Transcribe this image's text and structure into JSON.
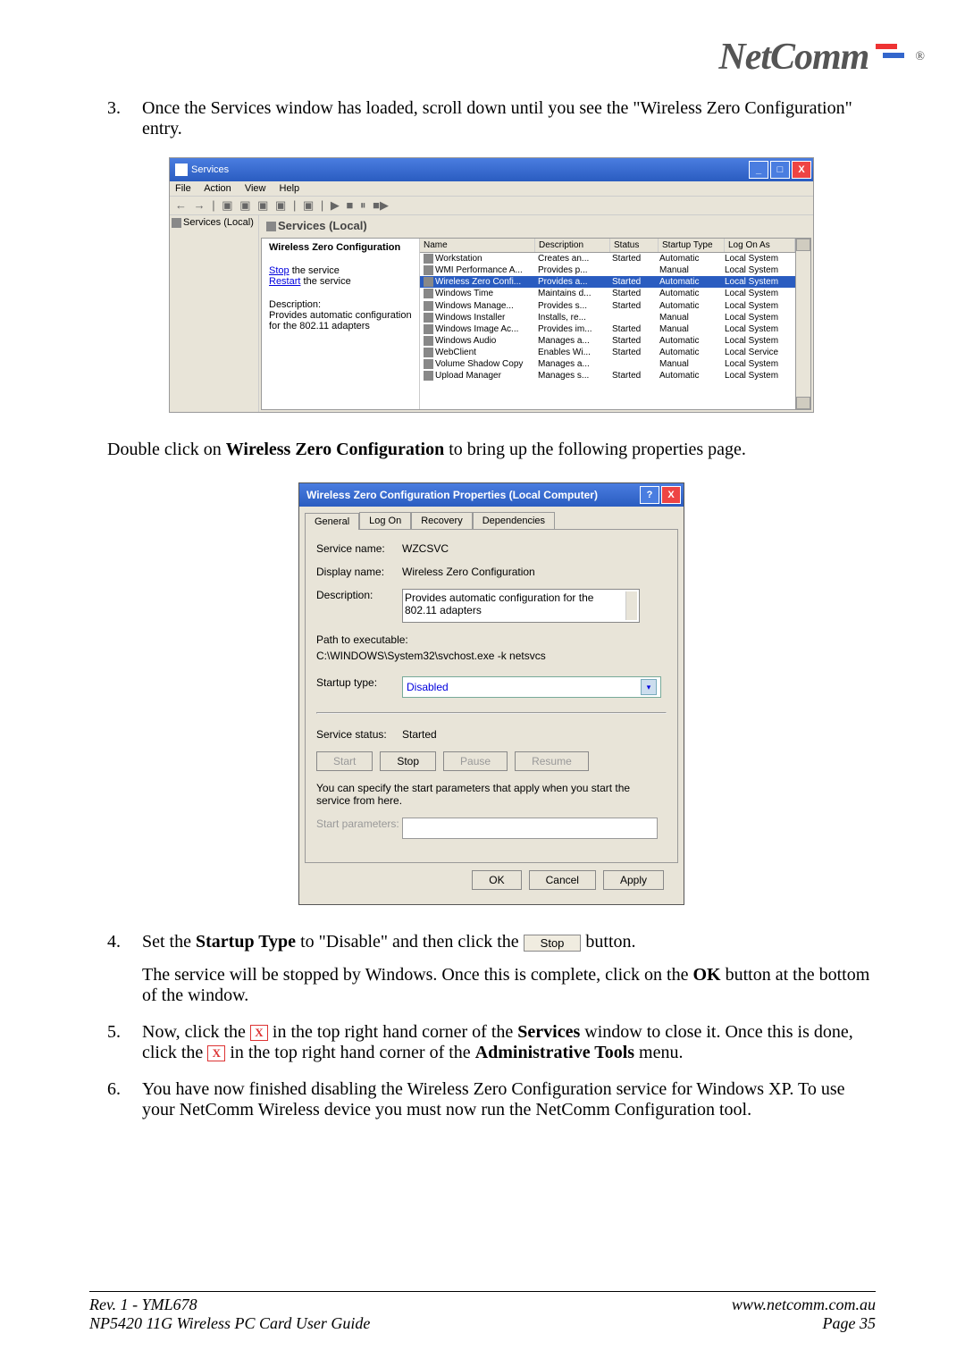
{
  "logo": "NetComm",
  "items": {
    "i3": {
      "num": "3.",
      "text": "Once the Services window has loaded, scroll down until you see the \"Wireless Zero Configuration\" entry."
    },
    "i4": {
      "num": "4.",
      "p1a": "Set the ",
      "p1b": "Startup Type",
      "p1c": " to \"Disable\" and then click the ",
      "btn": "Stop",
      "p1d": " button.",
      "p2a": "The service will be stopped by Windows. Once this is complete, click on the ",
      "p2b": "OK",
      "p2c": " button at the bottom of the window."
    },
    "i5": {
      "num": "5.",
      "p1a": "Now, click the ",
      "p1b": " in the top right hand corner of the ",
      "p1c": "Services",
      "p1d": " window to close it. Once this is done, click the ",
      "p1e": " in the top right hand corner of the ",
      "p1f": "Administrative Tools",
      "p1g": " menu."
    },
    "i6": {
      "num": "6.",
      "text": "You have now finished disabling the Wireless Zero Configuration service for Windows XP. To use your NetComm Wireless device you must now run the NetComm Configuration tool."
    }
  },
  "mid_text": {
    "a": "Double click on ",
    "b": "Wireless Zero Configuration",
    "c": " to bring up the following properties page."
  },
  "svc": {
    "title": "Services",
    "menu": [
      "File",
      "Action",
      "View",
      "Help"
    ],
    "tree": "Services (Local)",
    "header": "Services (Local)",
    "left": {
      "name": "Wireless Zero Configuration",
      "stop": "Stop",
      "stop2": " the service",
      "restart": "Restart",
      "restart2": " the service",
      "desc_h": "Description:",
      "desc": "Provides automatic configuration for the 802.11 adapters"
    },
    "cols": [
      "Name",
      "Description",
      "Status",
      "Startup Type",
      "Log On As"
    ],
    "rows": [
      [
        "Workstation",
        "Creates an...",
        "Started",
        "Automatic",
        "Local System"
      ],
      [
        "WMI Performance A...",
        "Provides p...",
        "",
        "Manual",
        "Local System"
      ],
      [
        "Wireless Zero Confi...",
        "Provides a...",
        "Started",
        "Automatic",
        "Local System"
      ],
      [
        "Windows Time",
        "Maintains d...",
        "Started",
        "Automatic",
        "Local System"
      ],
      [
        "Windows Manage...",
        "Provides s...",
        "Started",
        "Automatic",
        "Local System"
      ],
      [
        "Windows Installer",
        "Installs, re...",
        "",
        "Manual",
        "Local System"
      ],
      [
        "Windows Image Ac...",
        "Provides im...",
        "Started",
        "Manual",
        "Local System"
      ],
      [
        "Windows Audio",
        "Manages a...",
        "Started",
        "Automatic",
        "Local System"
      ],
      [
        "WebClient",
        "Enables Wi...",
        "Started",
        "Automatic",
        "Local Service"
      ],
      [
        "Volume Shadow Copy",
        "Manages a...",
        "",
        "Manual",
        "Local System"
      ],
      [
        "Upload Manager",
        "Manages s...",
        "Started",
        "Automatic",
        "Local System"
      ]
    ]
  },
  "props": {
    "title": "Wireless Zero Configuration Properties (Local Computer)",
    "tabs": [
      "General",
      "Log On",
      "Recovery",
      "Dependencies"
    ],
    "svc_name_l": "Service name:",
    "svc_name": "WZCSVC",
    "disp_l": "Display name:",
    "disp": "Wireless Zero Configuration",
    "desc_l": "Description:",
    "desc": "Provides automatic configuration for the 802.11 adapters",
    "path_l": "Path to executable:",
    "path": "C:\\WINDOWS\\System32\\svchost.exe -k netsvcs",
    "startup_l": "Startup type:",
    "startup": "Disabled",
    "status_l": "Service status:",
    "status": "Started",
    "btns": [
      "Start",
      "Stop",
      "Pause",
      "Resume"
    ],
    "note": "You can specify the start parameters that apply when you start the service from here.",
    "params_l": "Start parameters:",
    "bottom": [
      "OK",
      "Cancel",
      "Apply"
    ]
  },
  "footer": {
    "left1": "Rev. 1 - YML678",
    "left2": "NP5420 11G Wireless PC Card User Guide",
    "right1": "www.netcomm.com.au",
    "right2": "Page 35"
  }
}
